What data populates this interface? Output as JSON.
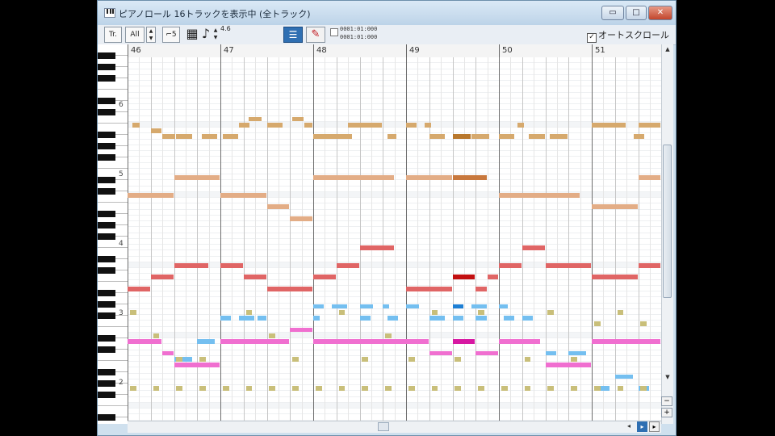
{
  "window": {
    "title": "ピアノロール 16トラックを表示中 (全トラック)",
    "buttons": {
      "minimize": "▭",
      "maximize": "□",
      "close": "✕"
    }
  },
  "toolbar": {
    "tr_label": "Tr.",
    "track_select": "All",
    "duration_label": "⌐5",
    "note_icon": "♪",
    "note_value": "4.6",
    "position_a": "0001:01:000",
    "position_b": "0001:01:000",
    "auto_scroll_checked": "✓",
    "auto_scroll_label": "オートスクロール"
  },
  "ruler": {
    "measures": [
      "46",
      "47",
      "48",
      "49",
      "50",
      "51"
    ]
  },
  "keyboard": {
    "labels": [
      "6",
      "5",
      "4",
      "3",
      "2"
    ]
  },
  "scroll": {
    "up": "▲",
    "down": "▼",
    "left": "◂",
    "right1": "▸",
    "right2": "▸",
    "zoom_minus": "−",
    "zoom_plus": "+"
  },
  "colors": {
    "tan": "#d6a96d",
    "tan_dark": "#b8772c",
    "peach": "#e3ad86",
    "peach_dark": "#c8783d",
    "red": "#e06565",
    "red_dark": "#c20f10",
    "blue": "#74bff0",
    "blue_dark": "#1e7fd4",
    "pink": "#f06fd0",
    "pink_dark": "#d718a2",
    "olive": "#c9bf7a"
  }
}
